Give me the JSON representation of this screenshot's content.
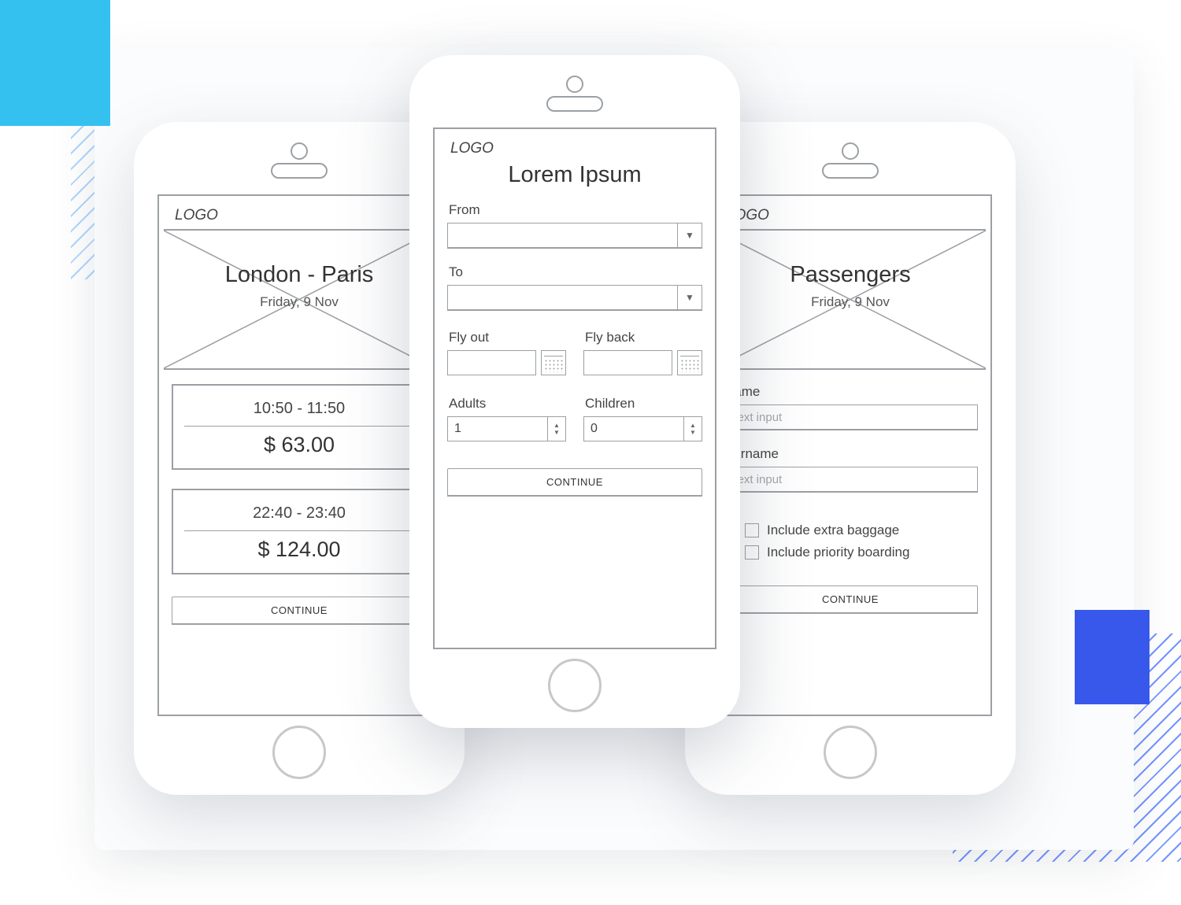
{
  "logo_text": "LOGO",
  "continue_label": "CONTINUE",
  "placeholder_text": "Text input",
  "left": {
    "title": "London - Paris",
    "subtitle": "Friday, 9 Nov",
    "flights": [
      {
        "time": "10:50 - 11:50",
        "price": "$ 63.00"
      },
      {
        "time": "22:40 - 23:40",
        "price": "$ 124.00"
      }
    ]
  },
  "center": {
    "title": "Lorem Ipsum",
    "from_label": "From",
    "to_label": "To",
    "flyout_label": "Fly out",
    "flyback_label": "Fly back",
    "adults_label": "Adults",
    "children_label": "Children",
    "adults_value": "1",
    "children_value": "0"
  },
  "right": {
    "title": "Passengers",
    "subtitle": "Friday, 9 Nov",
    "name_label": "Name",
    "surname_label": "Surname",
    "baggage_label": "Include extra baggage",
    "priority_label": "Include priority boarding"
  }
}
